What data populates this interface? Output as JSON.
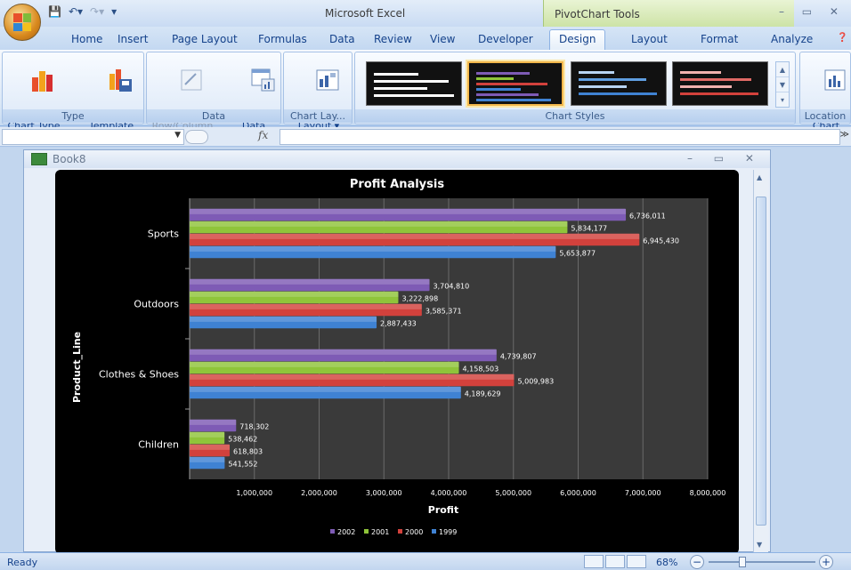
{
  "app": {
    "title": "Microsoft Excel",
    "context_tools_title": "PivotChart Tools",
    "window_controls": "– ▭ ✕"
  },
  "tabs": [
    "Home",
    "Insert",
    "Page Layout",
    "Formulas",
    "Data",
    "Review",
    "View",
    "Developer",
    "Design",
    "Layout",
    "Format",
    "Analyze"
  ],
  "active_tab": "Design",
  "ribbon": {
    "type_group": {
      "label": "Type",
      "change_chart_type": "Change\nChart Type",
      "save_as_template": "Save As\nTemplate"
    },
    "data_group": {
      "label": "Data",
      "switch_row_column": "Switch\nRow/Column",
      "select_data": "Select\nData"
    },
    "chart_layouts_group": {
      "label": "Chart Lay...",
      "quick_layout": "Quick\nLayout ▾"
    },
    "chart_styles_group": {
      "label": "Chart Styles"
    },
    "location_group": {
      "label": "Location",
      "move_chart": "Move\nChart"
    }
  },
  "formula_bar": {
    "name_box_value": "",
    "fx_label": "fx",
    "formula_value": ""
  },
  "workbook": {
    "name": "Book8",
    "controls": "– ▭ ✕"
  },
  "status": {
    "ready": "Ready",
    "zoom": "68%"
  },
  "colors": {
    "s2002": "#7e5bb5",
    "s2001": "#8fc43a",
    "s2000": "#d2413c",
    "s1999": "#3f82d3",
    "chart_bg": "#000000",
    "plot_bg": "#3a3a3a"
  },
  "chart_data": {
    "type": "bar",
    "orientation": "horizontal",
    "title": "Profit Analysis",
    "xlabel": "Profit",
    "ylabel": "Product_Line",
    "categories": [
      "Sports",
      "Outdoors",
      "Clothes & Shoes",
      "Children"
    ],
    "xlim": [
      0,
      8000000
    ],
    "x_ticks": [
      "1,000,000",
      "2,000,000",
      "3,000,000",
      "4,000,000",
      "5,000,000",
      "6,000,000",
      "7,000,000",
      "8,000,000"
    ],
    "legend_position": "bottom",
    "series": [
      {
        "name": "2002",
        "values": [
          6736011,
          3704810,
          4739807,
          718302
        ],
        "labels": [
          "6,736,011",
          "3,704,810",
          "4,739,807",
          "718,302"
        ]
      },
      {
        "name": "2001",
        "values": [
          5834177,
          3222898,
          4158503,
          538462
        ],
        "labels": [
          "5,834,177",
          "3,222,898",
          "4,158,503",
          "538,462"
        ]
      },
      {
        "name": "2000",
        "values": [
          6945430,
          3585371,
          5009983,
          618803
        ],
        "labels": [
          "6,945,430",
          "3,585,371",
          "5,009,983",
          "618,803"
        ]
      },
      {
        "name": "1999",
        "values": [
          5653877,
          2887433,
          4189629,
          541552
        ],
        "labels": [
          "5,653,877",
          "2,887,433",
          "4,189,629",
          "541,552"
        ]
      }
    ]
  }
}
